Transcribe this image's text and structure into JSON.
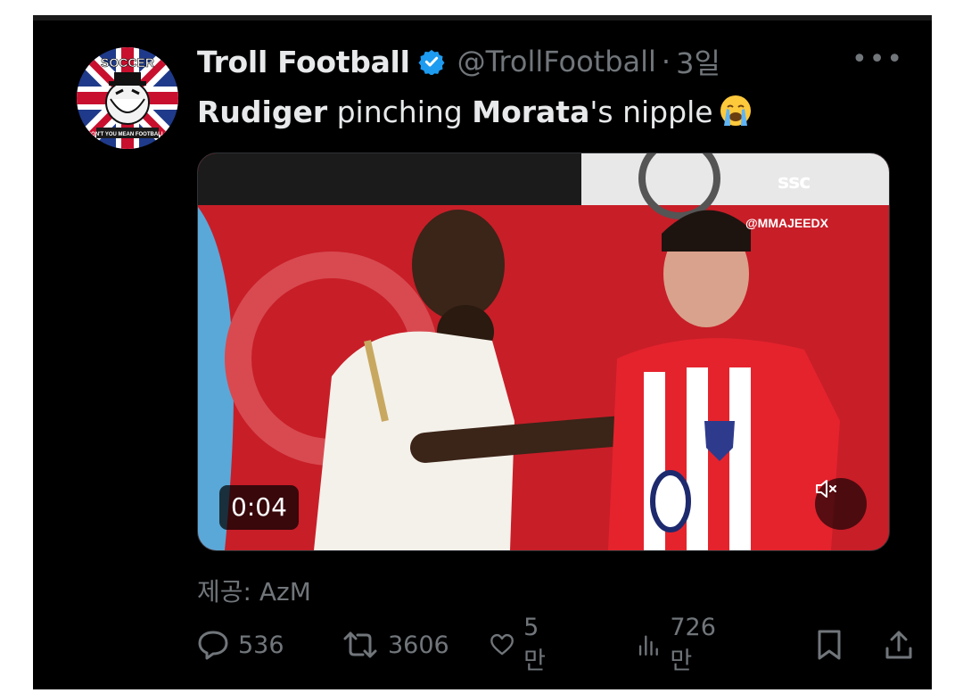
{
  "tweet": {
    "author_name": "Troll Football",
    "handle": "@TrollFootball",
    "time": "3일",
    "more_label": "•••",
    "text_parts": {
      "p1": "Rudiger",
      "p2": " pinching ",
      "p3": "Morata",
      "p4": "'s nipple"
    },
    "emoji": "loudly-crying-face",
    "video": {
      "duration": "0:04",
      "broadcaster": "ssc",
      "watermark": "@MMAJEEDX"
    },
    "source": "제공: AzM",
    "stats": {
      "replies": "536",
      "retweets": "3606",
      "likes": "5만",
      "views": "726만"
    }
  },
  "avatar_text": {
    "top": "SOCCER",
    "bottom": "DON'T YOU MEAN FOOTBALL?"
  },
  "colors": {
    "background": "#000000",
    "text": "#e7e9ea",
    "muted": "#71767b",
    "verified": "#1d9bf0"
  }
}
